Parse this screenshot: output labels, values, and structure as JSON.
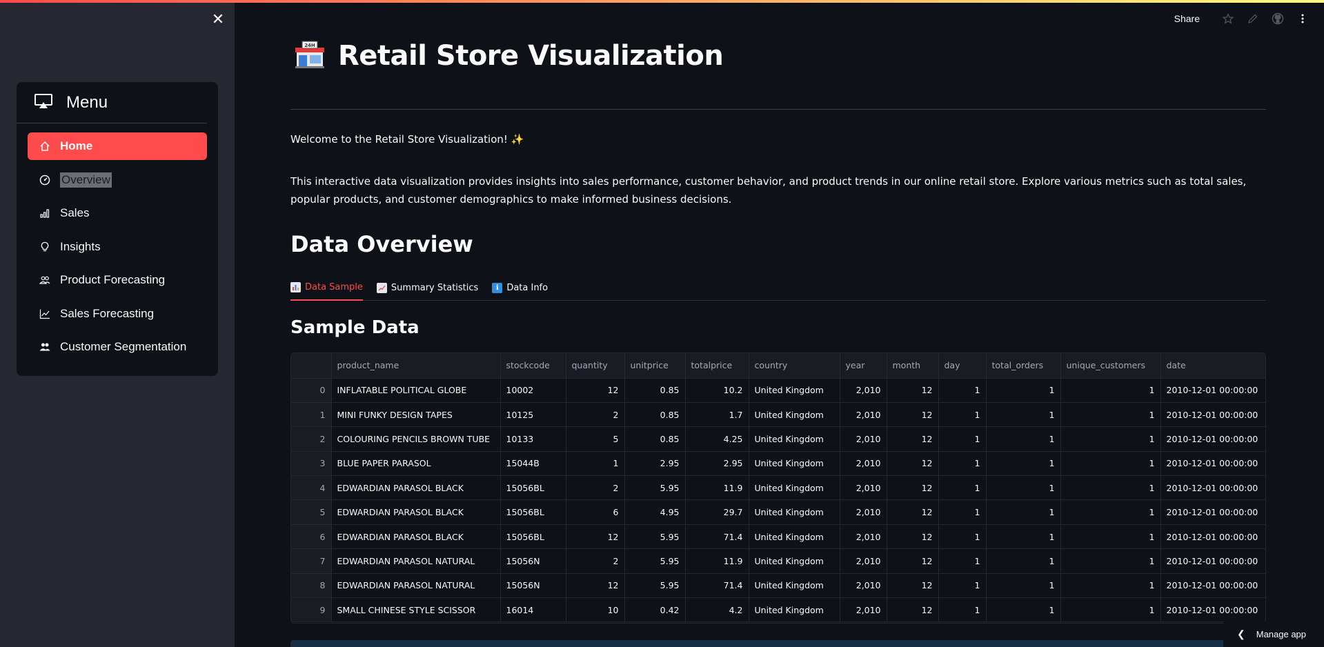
{
  "sidebar": {
    "close_label": "✕",
    "menu_title": "Menu",
    "items": [
      {
        "label": "Home",
        "icon": "home-icon"
      },
      {
        "label": "Overview",
        "icon": "gauge-icon"
      },
      {
        "label": "Sales",
        "icon": "bar-chart-icon"
      },
      {
        "label": "Insights",
        "icon": "lightbulb-icon"
      },
      {
        "label": "Product Forecasting",
        "icon": "people-icon"
      },
      {
        "label": "Sales Forecasting",
        "icon": "line-chart-icon"
      },
      {
        "label": "Customer Segmentation",
        "icon": "people-fill-icon"
      }
    ]
  },
  "toolbar": {
    "share_label": "Share"
  },
  "page": {
    "title_emoji": "🏪",
    "title": "Retail Store Visualization",
    "welcome": "Welcome to the Retail Store Visualization! ✨",
    "intro": "This interactive data visualization provides insights into sales performance, customer behavior, and product trends in our online retail store. Explore various metrics such as total sales, popular products, and customer demographics to make informed business decisions.",
    "section_title": "Data Overview",
    "tabs": [
      {
        "label": "Data Sample",
        "icon": "📊"
      },
      {
        "label": "Summary Statistics",
        "icon": "📈"
      },
      {
        "label": "Data Info",
        "icon": "ℹ"
      }
    ],
    "subsection_title": "Sample Data"
  },
  "table": {
    "columns": [
      "",
      "product_name",
      "stockcode",
      "quantity",
      "unitprice",
      "totalprice",
      "country",
      "year",
      "month",
      "day",
      "total_orders",
      "unique_customers",
      "date"
    ],
    "rows": [
      [
        "0",
        "INFLATABLE POLITICAL GLOBE",
        "10002",
        "12",
        "0.85",
        "10.2",
        "United Kingdom",
        "2,010",
        "12",
        "1",
        "1",
        "1",
        "2010-12-01 00:00:00"
      ],
      [
        "1",
        "MINI FUNKY DESIGN TAPES",
        "10125",
        "2",
        "0.85",
        "1.7",
        "United Kingdom",
        "2,010",
        "12",
        "1",
        "1",
        "1",
        "2010-12-01 00:00:00"
      ],
      [
        "2",
        "COLOURING PENCILS BROWN TUBE",
        "10133",
        "5",
        "0.85",
        "4.25",
        "United Kingdom",
        "2,010",
        "12",
        "1",
        "1",
        "1",
        "2010-12-01 00:00:00"
      ],
      [
        "3",
        "BLUE PAPER PARASOL",
        "15044B",
        "1",
        "2.95",
        "2.95",
        "United Kingdom",
        "2,010",
        "12",
        "1",
        "1",
        "1",
        "2010-12-01 00:00:00"
      ],
      [
        "4",
        "EDWARDIAN PARASOL BLACK",
        "15056BL",
        "2",
        "5.95",
        "11.9",
        "United Kingdom",
        "2,010",
        "12",
        "1",
        "1",
        "1",
        "2010-12-01 00:00:00"
      ],
      [
        "5",
        "EDWARDIAN PARASOL BLACK",
        "15056BL",
        "6",
        "4.95",
        "29.7",
        "United Kingdom",
        "2,010",
        "12",
        "1",
        "1",
        "1",
        "2010-12-01 00:00:00"
      ],
      [
        "6",
        "EDWARDIAN PARASOL BLACK",
        "15056BL",
        "12",
        "5.95",
        "71.4",
        "United Kingdom",
        "2,010",
        "12",
        "1",
        "1",
        "1",
        "2010-12-01 00:00:00"
      ],
      [
        "7",
        "EDWARDIAN PARASOL NATURAL",
        "15056N",
        "2",
        "5.95",
        "11.9",
        "United Kingdom",
        "2,010",
        "12",
        "1",
        "1",
        "1",
        "2010-12-01 00:00:00"
      ],
      [
        "8",
        "EDWARDIAN PARASOL NATURAL",
        "15056N",
        "12",
        "5.95",
        "71.4",
        "United Kingdom",
        "2,010",
        "12",
        "1",
        "1",
        "1",
        "2010-12-01 00:00:00"
      ],
      [
        "9",
        "SMALL CHINESE STYLE SCISSOR",
        "16014",
        "10",
        "0.42",
        "4.2",
        "United Kingdom",
        "2,010",
        "12",
        "1",
        "1",
        "1",
        "2010-12-01 00:00:00"
      ]
    ]
  },
  "manage_app_label": "Manage app",
  "colors": {
    "accent": "#ff4b4b",
    "background": "#0e1117",
    "sidebar": "#262730"
  }
}
